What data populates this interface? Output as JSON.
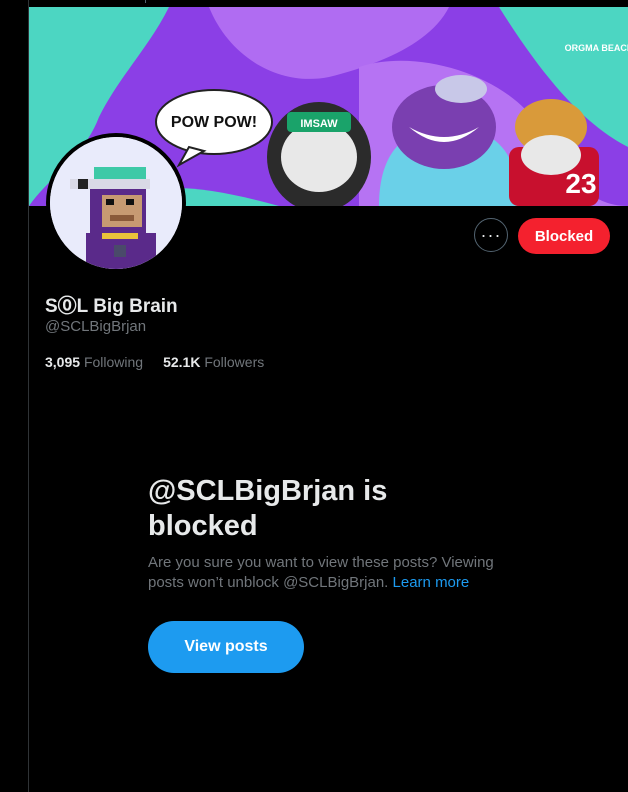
{
  "profile": {
    "display_name": "S⓪L Big Brain",
    "handle": "@SCLBigBrjan",
    "following_count": "3,095",
    "following_label": "Following",
    "followers_count": "52.1K",
    "followers_label": "Followers"
  },
  "banner": {
    "speech_text": "POW POW!",
    "logo_text": "ORGMA BEACH",
    "jersey_number": "23",
    "cap_text": "IMSAW"
  },
  "actions": {
    "more_label": "···",
    "blocked_label": "Blocked"
  },
  "blocked_notice": {
    "title": "@SCLBigBrjan is blocked",
    "description": "Are you sure you want to view these posts? Viewing posts won’t unblock @SCLBigBrjan.",
    "learn_more": "Learn more",
    "view_posts_label": "View posts"
  },
  "colors": {
    "accent": "#1d9bf0",
    "blocked_red": "#f4212e",
    "background": "#000000",
    "muted_text": "#71767b"
  }
}
